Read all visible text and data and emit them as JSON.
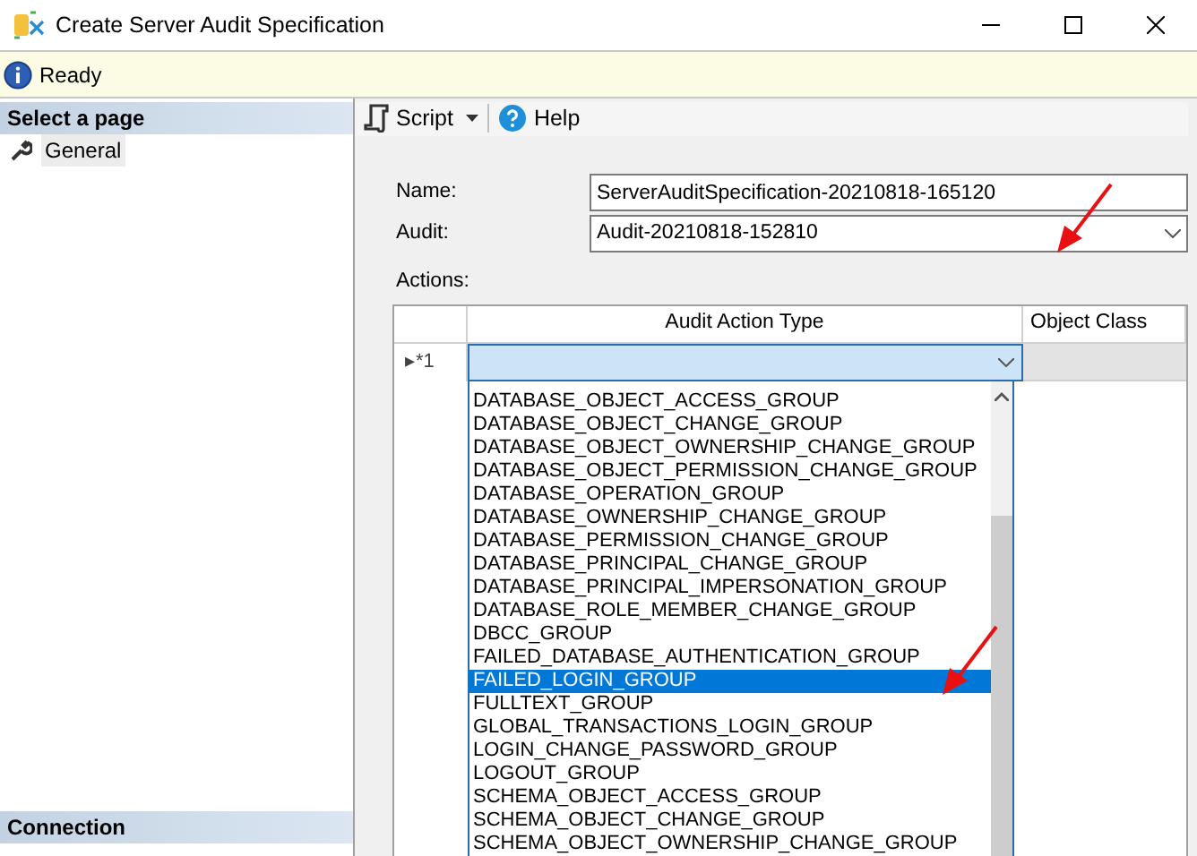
{
  "window": {
    "title": "Create Server Audit Specification"
  },
  "status": {
    "text": "Ready"
  },
  "sidebar": {
    "header": "Select a page",
    "items": [
      {
        "label": "General",
        "selected": true
      }
    ],
    "connection_header": "Connection"
  },
  "toolbar": {
    "buttons": [
      {
        "label": "Script",
        "kind": "script"
      },
      {
        "label": "Help",
        "kind": "help"
      }
    ]
  },
  "form": {
    "fields": [
      {
        "label": "Name:",
        "value": "ServerAuditSpecification-20210818-165120",
        "kind": "text"
      },
      {
        "label": "Audit:",
        "value": "Audit-20210818-152810",
        "kind": "select"
      }
    ],
    "actions_label": "Actions:",
    "table": {
      "columns": [
        "Audit Action Type",
        "Object Class"
      ],
      "rows": [
        {
          "row_header": "▸*1"
        }
      ]
    },
    "dropdown": {
      "items": [
        {
          "label": "DATABASE_OBJECT_ACCESS_GROUP",
          "selected": false
        },
        {
          "label": "DATABASE_OBJECT_CHANGE_GROUP",
          "selected": false
        },
        {
          "label": "DATABASE_OBJECT_OWNERSHIP_CHANGE_GROUP",
          "selected": false
        },
        {
          "label": "DATABASE_OBJECT_PERMISSION_CHANGE_GROUP",
          "selected": false
        },
        {
          "label": "DATABASE_OPERATION_GROUP",
          "selected": false
        },
        {
          "label": "DATABASE_OWNERSHIP_CHANGE_GROUP",
          "selected": false
        },
        {
          "label": "DATABASE_PERMISSION_CHANGE_GROUP",
          "selected": false
        },
        {
          "label": "DATABASE_PRINCIPAL_CHANGE_GROUP",
          "selected": false
        },
        {
          "label": "DATABASE_PRINCIPAL_IMPERSONATION_GROUP",
          "selected": false
        },
        {
          "label": "DATABASE_ROLE_MEMBER_CHANGE_GROUP",
          "selected": false
        },
        {
          "label": "DBCC_GROUP",
          "selected": false
        },
        {
          "label": "FAILED_DATABASE_AUTHENTICATION_GROUP",
          "selected": false
        },
        {
          "label": "FAILED_LOGIN_GROUP",
          "selected": true
        },
        {
          "label": "FULLTEXT_GROUP",
          "selected": false
        },
        {
          "label": "GLOBAL_TRANSACTIONS_LOGIN_GROUP",
          "selected": false
        },
        {
          "label": "LOGIN_CHANGE_PASSWORD_GROUP",
          "selected": false
        },
        {
          "label": "LOGOUT_GROUP",
          "selected": false
        },
        {
          "label": "SCHEMA_OBJECT_ACCESS_GROUP",
          "selected": false
        },
        {
          "label": "SCHEMA_OBJECT_CHANGE_GROUP",
          "selected": false
        },
        {
          "label": "SCHEMA_OBJECT_OWNERSHIP_CHANGE_GROUP",
          "selected": false
        }
      ]
    }
  }
}
